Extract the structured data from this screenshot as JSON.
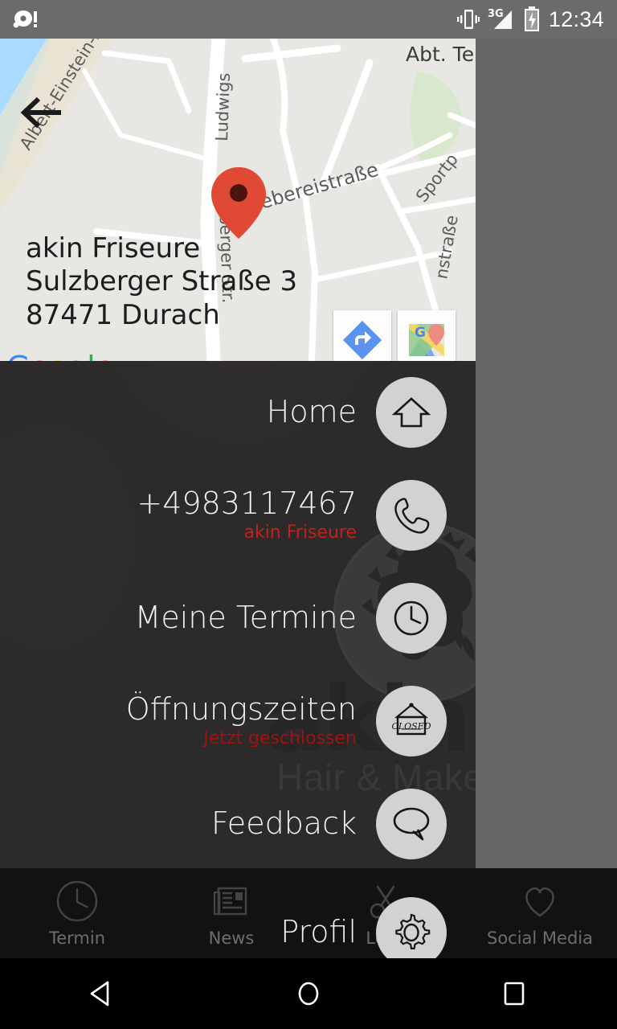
{
  "status_bar": {
    "time": "12:34",
    "icons": [
      "alarm-notification-icon",
      "vibrate-icon",
      "signal-3g-icon",
      "battery-charging-icon"
    ],
    "network_label": "3G"
  },
  "map_card": {
    "back_icon": "back-arrow-icon",
    "place_name": "akin Friseure",
    "street": "Sulzberger Straße 3",
    "city": "87471 Durach",
    "attribution": "Google",
    "attribution_letters": [
      "G",
      "o",
      "o",
      "g",
      "l",
      "e"
    ],
    "attribution_colors": [
      "#4285F4",
      "#EA4335",
      "#FBBC05",
      "#4285F4",
      "#34A853",
      "#EA4335"
    ],
    "marker": "map-pin-icon",
    "marker_color": "#E04A35",
    "buttons": [
      {
        "name": "directions-button",
        "icon": "directions-arrow-icon"
      },
      {
        "name": "open-in-maps-button",
        "icon": "google-maps-app-icon"
      }
    ],
    "street_labels": [
      "Albert-Einstein-S",
      "Ludwigs",
      "Sulzberger Straße",
      "Webereistraße",
      "Sportp",
      "Abt. Te",
      "nstraße"
    ]
  },
  "menu": {
    "items": [
      {
        "label": "Home",
        "sub": "",
        "icon": "home-icon"
      },
      {
        "label": "+4983117467",
        "sub": "akin Friseure",
        "icon": "phone-icon"
      },
      {
        "label": "Meine Termine",
        "sub": "",
        "icon": "clock-icon"
      },
      {
        "label": "Öffnungszeiten",
        "sub": "Jetzt geschlossen",
        "icon": "closed-sign-icon"
      },
      {
        "label": "Feedback",
        "sub": "",
        "icon": "speech-bubble-icon"
      },
      {
        "label": "Profil",
        "sub": "",
        "icon": "gear-icon"
      }
    ],
    "accent_color": "#c0221e",
    "icon_bg_color": "#d2d2d2"
  },
  "background": {
    "logo_word": "akin",
    "logo_tagline": "Hair & Make-Up"
  },
  "tab_bar": {
    "tabs": [
      {
        "label": "Termin",
        "icon": "clock-icon"
      },
      {
        "label": "News",
        "icon": "newspaper-icon"
      },
      {
        "label": "Leist",
        "icon": "scissors-icon"
      },
      {
        "label": "Social Media",
        "icon": "heart-icon"
      }
    ]
  },
  "nav_bar": {
    "buttons": [
      {
        "label": "Back",
        "icon": "triangle-back-icon"
      },
      {
        "label": "Home",
        "icon": "circle-home-icon"
      },
      {
        "label": "Recents",
        "icon": "square-recents-icon"
      }
    ]
  }
}
